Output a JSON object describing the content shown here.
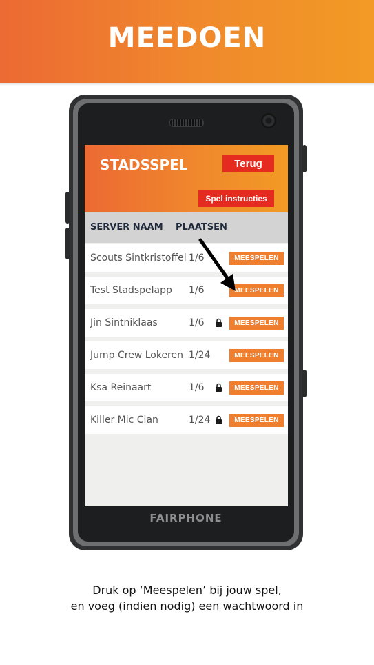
{
  "banner": {
    "title": "MEEDOEN"
  },
  "phone": {
    "brand": "FAIRPHONE"
  },
  "app": {
    "title": "STADSSPEL",
    "back_label": "Terug",
    "instructions_label": "Spel instructies",
    "columns": {
      "name": "SERVER NAAM",
      "places": "PLAATSEN"
    },
    "play_label": "MEESPELEN",
    "rows": [
      {
        "name": "Scouts Sintkristoffel",
        "places": "1/6",
        "locked": false
      },
      {
        "name": "Test Stadspelapp",
        "places": "1/6",
        "locked": false
      },
      {
        "name": "Jin Sintniklaas",
        "places": "1/6",
        "locked": true
      },
      {
        "name": "Jump Crew Lokeren",
        "places": "1/24",
        "locked": false
      },
      {
        "name": "Ksa Reinaart",
        "places": "1/6",
        "locked": true
      },
      {
        "name": "Killer Mic Clan",
        "places": "1/24",
        "locked": true
      }
    ]
  },
  "caption": {
    "line1": "Druk op  ‘Meespelen’ bij jouw spel,",
    "line2": "en voeg (indien nodig) een wachtwoord in"
  },
  "colors": {
    "accent": "#ef7f2e",
    "button_red": "#e52a20",
    "header_text": "#1f2a3c"
  },
  "icons": {
    "lock": "lock-icon",
    "pointer": "arrow-pointer-icon"
  }
}
